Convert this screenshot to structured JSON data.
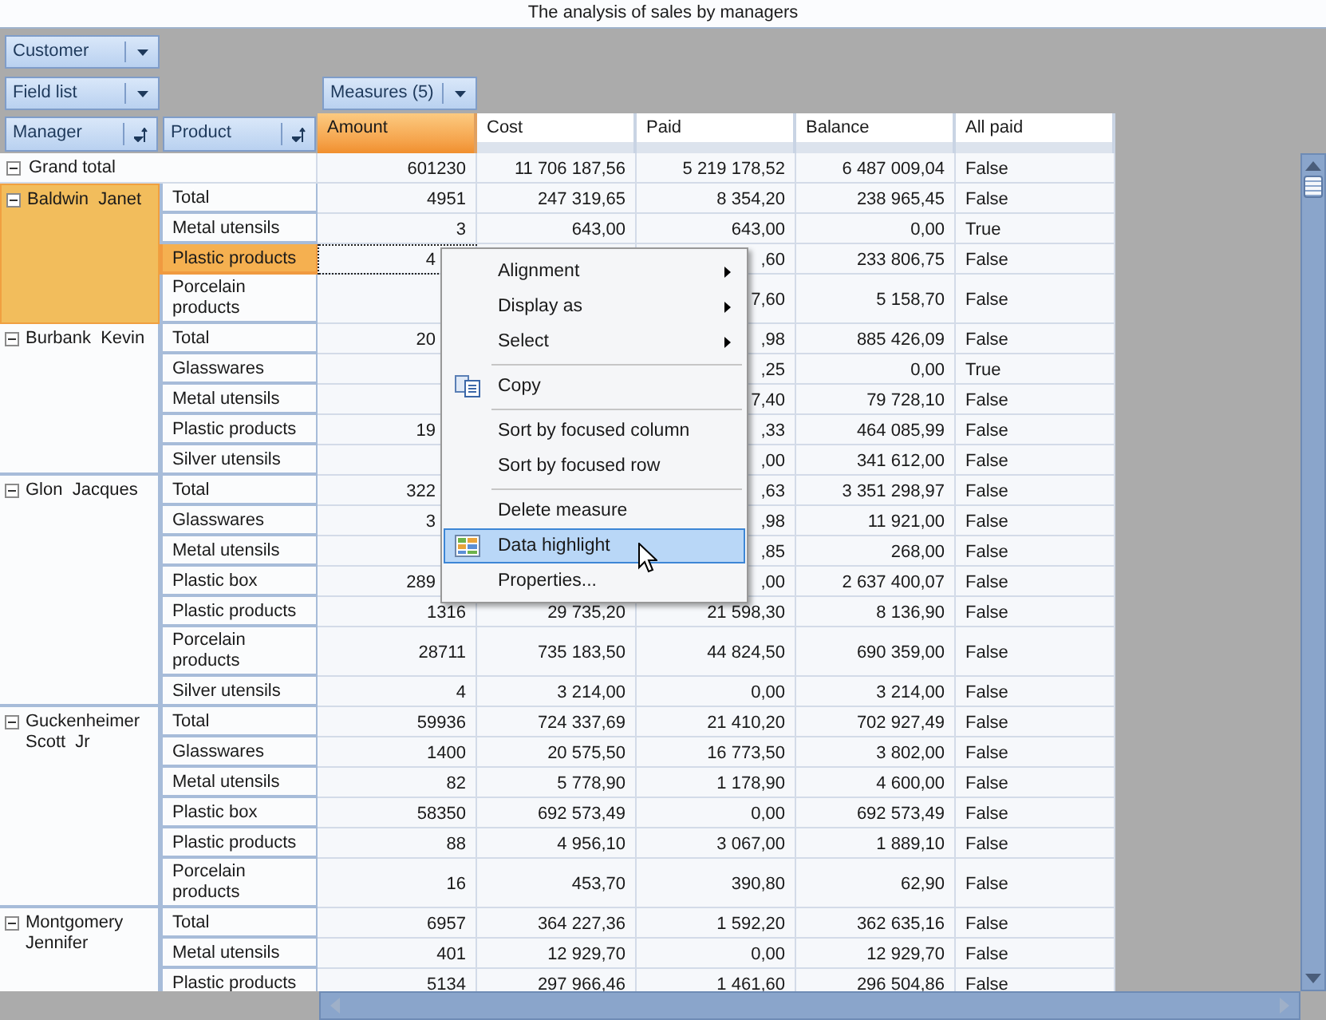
{
  "title": "The analysis of sales by managers",
  "filter_fields": [
    {
      "label": "Customer"
    }
  ],
  "field_list_button": {
    "label": "Field list"
  },
  "measures_button": {
    "label": "Measures (5)"
  },
  "row_fields": [
    {
      "label": "Manager"
    },
    {
      "label": "Product"
    }
  ],
  "columns": [
    {
      "label": "Amount",
      "selected": true
    },
    {
      "label": "Cost",
      "selected": false
    },
    {
      "label": "Paid",
      "selected": false
    },
    {
      "label": "Balance",
      "selected": false
    },
    {
      "label": "All paid",
      "selected": false
    }
  ],
  "grand_total": {
    "label": "Grand total",
    "expanded": true,
    "amount": "601230",
    "cost": "11 706 187,56",
    "paid": "5 219 178,52",
    "balance": "6 487 009,04",
    "all_paid": "False"
  },
  "managers": [
    {
      "name": "Baldwin  Janet",
      "expanded": true,
      "selected": true,
      "rows": [
        {
          "product": "Total",
          "selected": false,
          "amount": "4951",
          "cost": "247 319,65",
          "paid": "8 354,20",
          "balance": "238 965,45",
          "all_paid": "False"
        },
        {
          "product": "Metal utensils",
          "selected": false,
          "amount": "3",
          "cost": "643,00",
          "paid": "643,00",
          "balance": "0,00",
          "all_paid": "True"
        },
        {
          "product": "Plastic products",
          "selected": true,
          "focused": true,
          "amount_cut": true,
          "amount": "4",
          "paid": ",60",
          "balance": "233 806,75",
          "all_paid": "False"
        },
        {
          "product": "Porcelain products",
          "selected": false,
          "paid": "7,60",
          "balance": "5 158,70",
          "all_paid": "False"
        }
      ]
    },
    {
      "name": "Burbank  Kevin",
      "expanded": true,
      "selected": false,
      "rows": [
        {
          "product": "Total",
          "selected": false,
          "amount_cut": true,
          "amount": "20",
          "paid": ",98",
          "balance": "885 426,09",
          "all_paid": "False"
        },
        {
          "product": "Glasswares",
          "selected": false,
          "paid": ",25",
          "balance": "0,00",
          "all_paid": "True"
        },
        {
          "product": "Metal utensils",
          "selected": false,
          "paid": "7,40",
          "balance": "79 728,10",
          "all_paid": "False"
        },
        {
          "product": "Plastic products",
          "selected": false,
          "amount_cut": true,
          "amount": "19",
          "paid": ",33",
          "balance": "464 085,99",
          "all_paid": "False"
        },
        {
          "product": "Silver utensils",
          "selected": false,
          "paid": ",00",
          "balance": "341 612,00",
          "all_paid": "False"
        }
      ]
    },
    {
      "name": "Glon  Jacques",
      "expanded": true,
      "selected": false,
      "rows": [
        {
          "product": "Total",
          "selected": false,
          "amount_cut": true,
          "amount": "322",
          "paid": ",63",
          "balance": "3 351 298,97",
          "all_paid": "False"
        },
        {
          "product": "Glasswares",
          "selected": false,
          "amount_cut": true,
          "amount": "3",
          "paid": ",98",
          "balance": "11 921,00",
          "all_paid": "False"
        },
        {
          "product": "Metal utensils",
          "selected": false,
          "paid": ",85",
          "balance": "268,00",
          "all_paid": "False"
        },
        {
          "product": "Plastic box",
          "selected": false,
          "amount_cut": true,
          "amount": "289",
          "paid": ",00",
          "balance": "2 637 400,07",
          "all_paid": "False"
        },
        {
          "product": "Plastic products",
          "selected": false,
          "amount": "1316",
          "cost": "29 735,20",
          "paid": "21 598,30",
          "balance": "8 136,90",
          "all_paid": "False"
        },
        {
          "product": "Porcelain products",
          "selected": false,
          "amount": "28711",
          "cost": "735 183,50",
          "paid": "44 824,50",
          "balance": "690 359,00",
          "all_paid": "False"
        },
        {
          "product": "Silver utensils",
          "selected": false,
          "amount": "4",
          "cost": "3 214,00",
          "paid": "0,00",
          "balance": "3 214,00",
          "all_paid": "False"
        }
      ]
    },
    {
      "name": "Guckenheimer  Scott  Jr",
      "expanded": true,
      "selected": false,
      "rows": [
        {
          "product": "Total",
          "selected": false,
          "amount": "59936",
          "cost": "724 337,69",
          "paid": "21 410,20",
          "balance": "702 927,49",
          "all_paid": "False"
        },
        {
          "product": "Glasswares",
          "selected": false,
          "amount": "1400",
          "cost": "20 575,50",
          "paid": "16 773,50",
          "balance": "3 802,00",
          "all_paid": "False"
        },
        {
          "product": "Metal utensils",
          "selected": false,
          "amount": "82",
          "cost": "5 778,90",
          "paid": "1 178,90",
          "balance": "4 600,00",
          "all_paid": "False"
        },
        {
          "product": "Plastic box",
          "selected": false,
          "amount": "58350",
          "cost": "692 573,49",
          "paid": "0,00",
          "balance": "692 573,49",
          "all_paid": "False"
        },
        {
          "product": "Plastic products",
          "selected": false,
          "amount": "88",
          "cost": "4 956,10",
          "paid": "3 067,00",
          "balance": "1 889,10",
          "all_paid": "False"
        },
        {
          "product": "Porcelain products",
          "selected": false,
          "amount": "16",
          "cost": "453,70",
          "paid": "390,80",
          "balance": "62,90",
          "all_paid": "False"
        }
      ]
    },
    {
      "name": "Montgomery Jennifer",
      "expanded": true,
      "selected": false,
      "rows": [
        {
          "product": "Total",
          "selected": false,
          "amount": "6957",
          "cost": "364 227,36",
          "paid": "1 592,20",
          "balance": "362 635,16",
          "all_paid": "False"
        },
        {
          "product": "Metal utensils",
          "selected": false,
          "amount": "401",
          "cost": "12 929,70",
          "paid": "0,00",
          "balance": "12 929,70",
          "all_paid": "False"
        },
        {
          "product": "Plastic products",
          "selected": false,
          "amount": "5134",
          "cost": "297 966,46",
          "paid": "1 461,60",
          "balance": "296 504,86",
          "all_paid": "False"
        }
      ]
    }
  ],
  "context_menu": {
    "items": [
      {
        "kind": "submenu",
        "label": "Alignment",
        "selected": false
      },
      {
        "kind": "submenu",
        "label": "Display as",
        "selected": false
      },
      {
        "kind": "submenu",
        "label": "Select",
        "selected": false
      },
      {
        "kind": "separator"
      },
      {
        "kind": "copy",
        "label": "Copy",
        "selected": false
      },
      {
        "kind": "separator"
      },
      {
        "kind": "plain",
        "label": "Sort by focused column",
        "selected": false
      },
      {
        "kind": "plain",
        "label": "Sort by focused row",
        "selected": false
      },
      {
        "kind": "separator"
      },
      {
        "kind": "plain",
        "label": "Delete measure",
        "selected": false
      },
      {
        "kind": "highlight",
        "label": "Data highlight",
        "selected": true
      },
      {
        "kind": "plain",
        "label": "Properties...",
        "selected": false
      }
    ]
  }
}
